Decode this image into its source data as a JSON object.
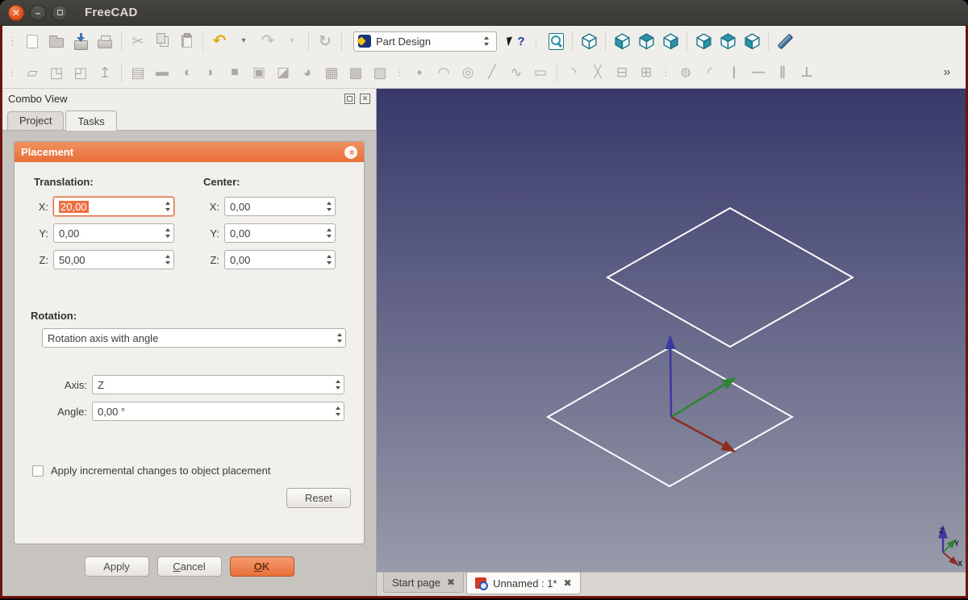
{
  "window": {
    "title": "FreeCAD"
  },
  "icons": {
    "close_tab": "✖",
    "collapse": "»",
    "grip": "⋮",
    "minimize": "–",
    "close_window": "✕"
  },
  "combo_view": {
    "title": "Combo View",
    "tabs": [
      {
        "label": "Project"
      },
      {
        "label": "Tasks"
      }
    ]
  },
  "placement": {
    "title": "Placement",
    "translation_label": "Translation:",
    "center_label": "Center:",
    "x_label": "X:",
    "y_label": "Y:",
    "z_label": "Z:",
    "translation": {
      "x": "20,00",
      "y": "0,00",
      "z": "50,00"
    },
    "center": {
      "x": "0,00",
      "y": "0,00",
      "z": "0,00"
    },
    "rotation_label": "Rotation:",
    "rotation_mode": "Rotation axis with angle",
    "axis_label": "Axis:",
    "axis_value": "Z",
    "angle_label": "Angle:",
    "angle_value": "0,00 °",
    "checkbox_label": "Apply incremental changes to object placement",
    "reset_label": "Reset",
    "apply_label": "Apply",
    "cancel_label": "Cancel",
    "ok_label": "OK"
  },
  "doc_tabs": [
    {
      "label": "Start page"
    },
    {
      "label": "Unnamed : 1*",
      "active": true
    }
  ],
  "viewport": {
    "bg_top": "#38386b",
    "bg_bottom": "#989baa",
    "wire_color": "#ffffff",
    "axis_colors": {
      "x": "#8f2c20",
      "y": "#2f8435",
      "z": "#3a3aa0"
    },
    "upper_square": "438,148 590,234 438,320 286,234",
    "lower_square": "363,321 515,407 363,493 212,407",
    "axis_z": "365,407 364,319",
    "axis_y": "365,407 434,365",
    "axis_x": "365,407 433,444",
    "mini_z": "702,575 702,554",
    "mini_y": "702,575 712,565",
    "mini_x": "702,575 714,585",
    "axis_labels": {
      "z": "Z",
      "y": "Y",
      "x": "X"
    }
  },
  "toolbars": {
    "row1": [
      {
        "t": "grip",
        "name": "toolbar-grip"
      },
      {
        "t": "css",
        "c": "i-page",
        "name": "new-document",
        "grayed": true
      },
      {
        "t": "css",
        "c": "i-folder",
        "name": "open-document",
        "grayed": true
      },
      {
        "t": "css",
        "c": "i-save",
        "name": "save-document"
      },
      {
        "t": "css",
        "c": "i-print",
        "name": "print-document",
        "grayed": true
      },
      {
        "t": "sep"
      },
      {
        "t": "glyph",
        "g": "✂",
        "name": "cut",
        "color": "#b6b3ad",
        "size": 18
      },
      {
        "t": "css",
        "c": "i-copy",
        "name": "copy",
        "grayed": true
      },
      {
        "t": "css",
        "c": "i-paste",
        "name": "paste",
        "grayed": true
      },
      {
        "t": "sep"
      },
      {
        "t": "glyph",
        "g": "↶",
        "name": "undo",
        "color": "#dfae0d",
        "size": 20,
        "bold": true
      },
      {
        "t": "glyph",
        "g": "▾",
        "name": "undo-history",
        "color": "#6f6d66",
        "size": 10
      },
      {
        "t": "glyph",
        "g": "↷",
        "name": "redo",
        "color": "#c9c6c0",
        "size": 20,
        "bold": true
      },
      {
        "t": "glyph",
        "g": "▾",
        "name": "redo-history",
        "color": "#c9c6c0",
        "size": 10
      },
      {
        "t": "sep"
      },
      {
        "t": "glyph",
        "g": "↻",
        "name": "refresh",
        "color": "#bbb8b2",
        "size": 19,
        "bold": true
      },
      {
        "t": "sep"
      },
      {
        "t": "wb",
        "name": "workbench-selector",
        "label": "Part Design"
      },
      {
        "t": "css",
        "c": "i-help",
        "name": "whats-this",
        "g": "?"
      },
      {
        "t": "grip",
        "name": "toolbar-grip"
      },
      {
        "t": "css",
        "c": "i-fit",
        "name": "fit-all"
      },
      {
        "t": "sep"
      },
      {
        "t": "cube",
        "face": "none",
        "name": "axonometric-view"
      },
      {
        "t": "sep"
      },
      {
        "t": "cube",
        "face": "left",
        "name": "front-view"
      },
      {
        "t": "cube",
        "face": "top",
        "name": "top-view"
      },
      {
        "t": "cube",
        "face": "right",
        "name": "right-view"
      },
      {
        "t": "sep"
      },
      {
        "t": "cube",
        "face": "right",
        "name": "rear-view"
      },
      {
        "t": "cube",
        "face": "top",
        "name": "bottom-view"
      },
      {
        "t": "cube",
        "face": "left",
        "name": "left-view"
      },
      {
        "t": "sep"
      },
      {
        "t": "css",
        "c": "i-measure",
        "name": "measure-distance"
      }
    ],
    "row2": [
      {
        "t": "grip",
        "name": "toolbar-grip"
      },
      {
        "t": "glyph",
        "g": "▱",
        "name": "new-sketch",
        "grayed": true,
        "size": 18
      },
      {
        "t": "glyph",
        "g": "◳",
        "name": "view-sketch",
        "grayed": true,
        "size": 18
      },
      {
        "t": "glyph",
        "g": "◰",
        "name": "map-sketch",
        "grayed": true,
        "size": 18
      },
      {
        "t": "glyph",
        "g": "↥",
        "name": "leave-sketch",
        "grayed": true,
        "size": 18
      },
      {
        "t": "sep"
      },
      {
        "t": "glyph",
        "g": "▤",
        "name": "datum-plane",
        "grayed": true,
        "size": 18
      },
      {
        "t": "glyph",
        "g": "▬",
        "name": "pad",
        "grayed": true,
        "size": 16
      },
      {
        "t": "glyph",
        "g": "◖",
        "name": "revolution",
        "grayed": true,
        "size": 17
      },
      {
        "t": "glyph",
        "g": "◗",
        "name": "groove",
        "grayed": true,
        "size": 17
      },
      {
        "t": "glyph",
        "g": "■",
        "name": "additive-box",
        "grayed": true,
        "size": 16
      },
      {
        "t": "glyph",
        "g": "▣",
        "name": "pocket",
        "grayed": true,
        "size": 17
      },
      {
        "t": "glyph",
        "g": "◪",
        "name": "draft",
        "grayed": true,
        "size": 17
      },
      {
        "t": "glyph",
        "g": "◕",
        "name": "additive-pipe",
        "grayed": true,
        "size": 17
      },
      {
        "t": "glyph",
        "g": "▦",
        "name": "linear-pattern",
        "grayed": true,
        "size": 18
      },
      {
        "t": "glyph",
        "g": "▩",
        "name": "polar-pattern",
        "grayed": true,
        "size": 18
      },
      {
        "t": "glyph",
        "g": "▨",
        "name": "multitransform",
        "grayed": true,
        "size": 18
      },
      {
        "t": "grip",
        "name": "toolbar-grip"
      },
      {
        "t": "glyph",
        "g": "•",
        "name": "create-point",
        "grayed": true,
        "size": 18
      },
      {
        "t": "glyph",
        "g": "◠",
        "name": "create-arc",
        "grayed": true,
        "size": 18
      },
      {
        "t": "glyph",
        "g": "◎",
        "name": "create-circle",
        "grayed": true,
        "size": 17
      },
      {
        "t": "glyph",
        "g": "╱",
        "name": "create-line",
        "grayed": true,
        "size": 16
      },
      {
        "t": "glyph",
        "g": "∿",
        "name": "create-polyline",
        "grayed": true,
        "size": 17
      },
      {
        "t": "glyph",
        "g": "▭",
        "name": "create-rectangle",
        "grayed": true,
        "size": 17
      },
      {
        "t": "sep"
      },
      {
        "t": "glyph",
        "g": "◝",
        "name": "create-fillet",
        "grayed": true,
        "size": 17
      },
      {
        "t": "glyph",
        "g": "╳",
        "name": "trim-edge",
        "grayed": true,
        "size": 15
      },
      {
        "t": "glyph",
        "g": "⊟",
        "name": "extend-edge",
        "grayed": true,
        "size": 17
      },
      {
        "t": "glyph",
        "g": "⊞",
        "name": "external-geometry",
        "grayed": true,
        "size": 17
      },
      {
        "t": "grip",
        "name": "toolbar-grip"
      },
      {
        "t": "glyph",
        "g": "◍",
        "name": "constrain-lock",
        "grayed": true,
        "size": 15
      },
      {
        "t": "glyph",
        "g": "◜",
        "name": "constrain-tangent",
        "grayed": true,
        "size": 17
      },
      {
        "t": "glyph",
        "g": "|",
        "name": "constrain-vertical",
        "grayed": true,
        "size": 16,
        "bold": true
      },
      {
        "t": "glyph",
        "g": "—",
        "name": "constrain-horizontal",
        "grayed": true,
        "size": 16,
        "bold": true
      },
      {
        "t": "glyph",
        "g": "∥",
        "name": "constrain-parallel",
        "grayed": true,
        "size": 16,
        "bold": true
      },
      {
        "t": "glyph",
        "g": "⊥",
        "name": "constrain-perpendicular",
        "grayed": true,
        "size": 17,
        "bold": true
      },
      {
        "t": "glyph",
        "g": "»",
        "name": "toolbar-overflow",
        "color": "#55534e",
        "size": 16,
        "end": true
      }
    ]
  }
}
